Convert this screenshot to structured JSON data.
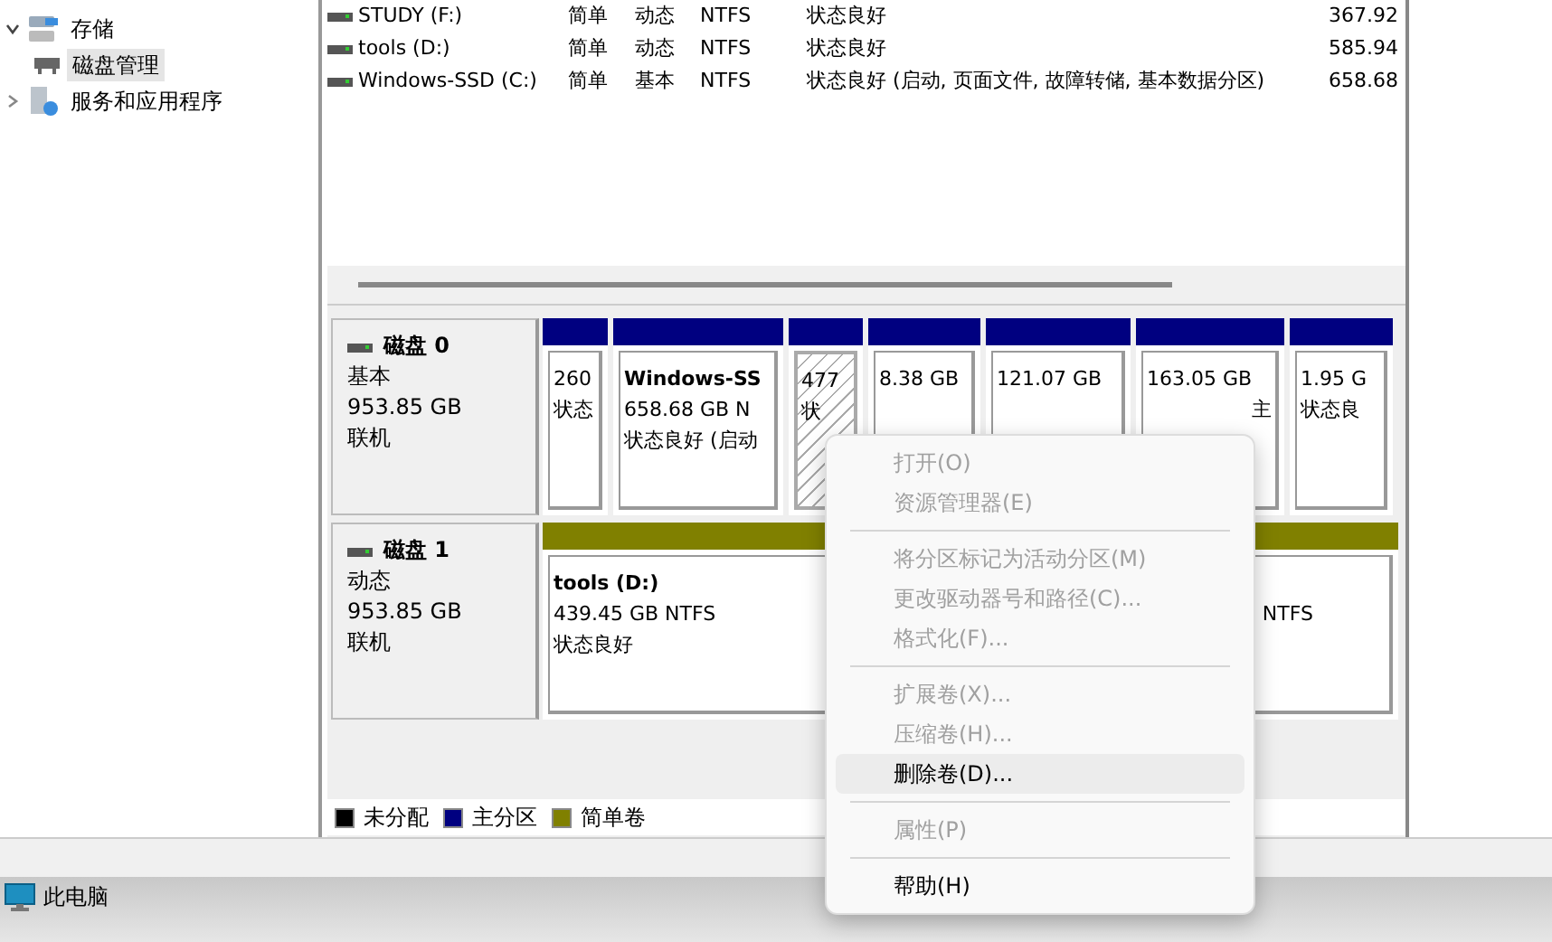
{
  "tree": [
    {
      "label": "存储",
      "expanded": true,
      "selected": false,
      "children": [
        {
          "label": "磁盘管理",
          "selected": true
        }
      ]
    },
    {
      "label": "服务和应用程序",
      "expanded": false,
      "selected": false
    }
  ],
  "volumes": [
    {
      "name": "STUDY (F:)",
      "layout": "简单",
      "type": "动态",
      "fs": "NTFS",
      "status": "状态良好",
      "capacity": "367.92"
    },
    {
      "name": "tools (D:)",
      "layout": "简单",
      "type": "动态",
      "fs": "NTFS",
      "status": "状态良好",
      "capacity": "585.94"
    },
    {
      "name": "Windows-SSD (C:)",
      "layout": "简单",
      "type": "基本",
      "fs": "NTFS",
      "status": "状态良好 (启动, 页面文件, 故障转储, 基本数据分区)",
      "capacity": "658.68"
    }
  ],
  "disks": [
    {
      "name": "磁盘 0",
      "type": "基本",
      "size": "953.85 GB",
      "status": "联机",
      "partitions": [
        {
          "kind": "primary",
          "selected": false,
          "lines": [
            "260",
            "状态"
          ]
        },
        {
          "kind": "primary",
          "selected": false,
          "title": "Windows-SS",
          "lines": [
            "658.68 GB N",
            "状态良好 (启动"
          ]
        },
        {
          "kind": "primary",
          "selected": true,
          "lines": [
            "477",
            "状"
          ]
        },
        {
          "kind": "primary",
          "selected": false,
          "lines": [
            "8.38 GB"
          ]
        },
        {
          "kind": "primary",
          "selected": false,
          "lines": [
            "121.07 GB"
          ]
        },
        {
          "kind": "primary",
          "selected": false,
          "lines": [
            "163.05 GB"
          ],
          "tail": "主"
        },
        {
          "kind": "primary",
          "selected": false,
          "lines": [
            "1.95 G",
            "状态良"
          ]
        }
      ]
    },
    {
      "name": "磁盘 1",
      "type": "动态",
      "size": "953.85 GB",
      "status": "联机",
      "partitions": [
        {
          "kind": "simple",
          "selected": false,
          "title": "tools  (D:)",
          "lines": [
            "439.45 GB NTFS",
            "状态良好"
          ]
        },
        {
          "kind": "simple",
          "selected": false,
          "tail": "NTFS"
        }
      ]
    }
  ],
  "legend": [
    {
      "label": "未分配",
      "color": "#000000"
    },
    {
      "label": "主分区",
      "color": "#000080"
    },
    {
      "label": "简单卷",
      "color": "#808000"
    }
  ],
  "taskbar": {
    "label": "此电脑"
  },
  "context_menu": [
    {
      "kind": "item",
      "label": "打开(O)",
      "disabled": true,
      "selected": false
    },
    {
      "kind": "item",
      "label": "资源管理器(E)",
      "disabled": true,
      "selected": false
    },
    {
      "kind": "separator"
    },
    {
      "kind": "item",
      "label": "将分区标记为活动分区(M)",
      "disabled": true,
      "selected": false
    },
    {
      "kind": "item",
      "label": "更改驱动器号和路径(C)...",
      "disabled": true,
      "selected": false
    },
    {
      "kind": "item",
      "label": "格式化(F)...",
      "disabled": true,
      "selected": false
    },
    {
      "kind": "separator"
    },
    {
      "kind": "item",
      "label": "扩展卷(X)...",
      "disabled": true,
      "selected": false
    },
    {
      "kind": "item",
      "label": "压缩卷(H)...",
      "disabled": true,
      "selected": false
    },
    {
      "kind": "item",
      "label": "删除卷(D)...",
      "disabled": false,
      "selected": true
    },
    {
      "kind": "separator"
    },
    {
      "kind": "item",
      "label": "属性(P)",
      "disabled": true,
      "selected": false
    },
    {
      "kind": "separator"
    },
    {
      "kind": "item",
      "label": "帮助(H)",
      "disabled": false,
      "selected": false
    }
  ]
}
